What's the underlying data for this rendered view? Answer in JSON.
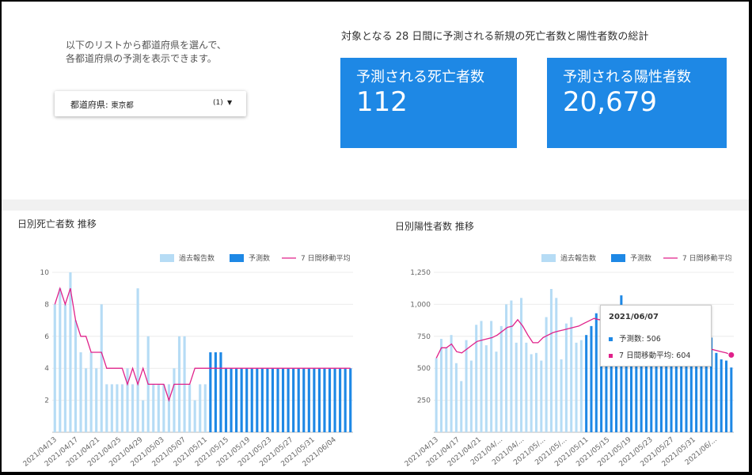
{
  "filter_panel": {
    "instruction_line1": "以下のリストから都道府県を選んで、",
    "instruction_line2": "各都道府県の予測を表示できます。",
    "dropdown_label": "都道府県",
    "dropdown_value": "東京都",
    "dropdown_count": "(1)"
  },
  "summary": {
    "title": "対象となる 28 日間に予測される新規の死亡者数と陽性者数の総計",
    "deaths_title": "予測される死亡者数",
    "deaths_value": "112",
    "cases_title": "予測される陽性者数",
    "cases_value": "20,679",
    "card_color": "#1e88e5"
  },
  "legend": {
    "reported": "過去報告数",
    "forecast": "予測数",
    "moving_avg": "7 日間移動平均"
  },
  "colors": {
    "reported": "#b6dcf5",
    "forecast": "#1e88e5",
    "moving_avg": "#e0218a"
  },
  "tooltip": {
    "date": "2021/06/07",
    "forecast_text": "予測数: 506",
    "avg_text": "7 日間移動平均: 604"
  },
  "chart_data": [
    {
      "type": "bar",
      "title": "日別死亡者数 推移",
      "x_ticks": [
        "2021/04/13",
        "2021/04/17",
        "2021/04/21",
        "2021/04/25",
        "2021/04/29",
        "2021/05/03",
        "2021/05/07",
        "2021/05/11",
        "2021/05/15",
        "2021/05/19",
        "2021/05/23",
        "2021/05/27",
        "2021/05/31",
        "2021/06/04"
      ],
      "y_ticks": [
        "10",
        "8",
        "6",
        "4",
        "2"
      ],
      "ylim": [
        0,
        10
      ],
      "grid": true,
      "legend_position": "top-right",
      "reported": [
        8,
        9,
        8,
        10,
        7,
        5,
        4,
        5,
        4,
        8,
        3,
        3,
        3,
        3,
        4,
        3,
        9,
        2,
        6,
        3,
        3,
        3,
        3,
        4,
        6,
        6,
        3,
        2,
        3,
        3
      ],
      "forecast": [
        5,
        5,
        5,
        4,
        4,
        4,
        4,
        4,
        4,
        4,
        4,
        4,
        4,
        4,
        4,
        4,
        4,
        4,
        4,
        4,
        4,
        4,
        4,
        4,
        4,
        4,
        4,
        4
      ],
      "moving_avg": [
        8,
        9,
        8,
        9,
        7,
        6,
        6,
        5,
        5,
        5,
        4,
        4,
        4,
        4,
        3,
        4,
        3,
        4,
        3,
        3,
        3,
        3,
        2,
        3,
        3,
        3,
        3,
        4,
        4,
        4,
        4,
        4,
        4,
        4,
        4,
        4,
        4,
        4,
        4,
        4,
        4,
        4,
        4,
        4,
        4,
        4,
        4,
        4,
        4,
        4,
        4,
        4,
        4,
        4,
        4,
        4,
        4,
        4
      ]
    },
    {
      "type": "bar",
      "title": "日別陽性者数 推移",
      "x_ticks": [
        "2021/04/13",
        "2021/04/17",
        "2021/04/21",
        "2021/04/...",
        "2021/04/...",
        "2021/05/...",
        "2021/05/...",
        "2021/05/11",
        "2021/05/15",
        "2021/05/19",
        "2021/05/23",
        "2021/05/27",
        "2021/05/31",
        "2021/06/..."
      ],
      "y_ticks": [
        "1,250",
        "1,000",
        "750",
        "500",
        "250"
      ],
      "ylim": [
        0,
        1250
      ],
      "grid": true,
      "legend_position": "top-right",
      "reported": [
        580,
        730,
        660,
        760,
        540,
        400,
        720,
        560,
        840,
        870,
        680,
        870,
        630,
        830,
        1000,
        1030,
        700,
        1050,
        700,
        610,
        620,
        560,
        900,
        1120,
        1050,
        570,
        850,
        900,
        700,
        720
      ],
      "forecast": [
        760,
        830,
        930,
        830,
        760,
        850,
        860,
        1070,
        860,
        760,
        760,
        760,
        760,
        760,
        760,
        760,
        760,
        760,
        760,
        760,
        760,
        760,
        760,
        760,
        760,
        740,
        620,
        570,
        560,
        506
      ],
      "moving_avg": [
        580,
        660,
        660,
        690,
        630,
        620,
        650,
        680,
        710,
        720,
        730,
        740,
        760,
        790,
        820,
        830,
        880,
        830,
        760,
        700,
        700,
        740,
        760,
        780,
        790,
        800,
        810,
        820,
        830,
        850,
        870,
        890,
        880,
        880,
        870,
        860,
        850,
        840,
        830,
        820,
        800,
        790,
        770,
        760,
        750,
        740,
        730,
        720,
        710,
        700,
        690,
        680,
        670,
        660,
        650,
        640,
        630,
        620,
        604
      ]
    }
  ]
}
